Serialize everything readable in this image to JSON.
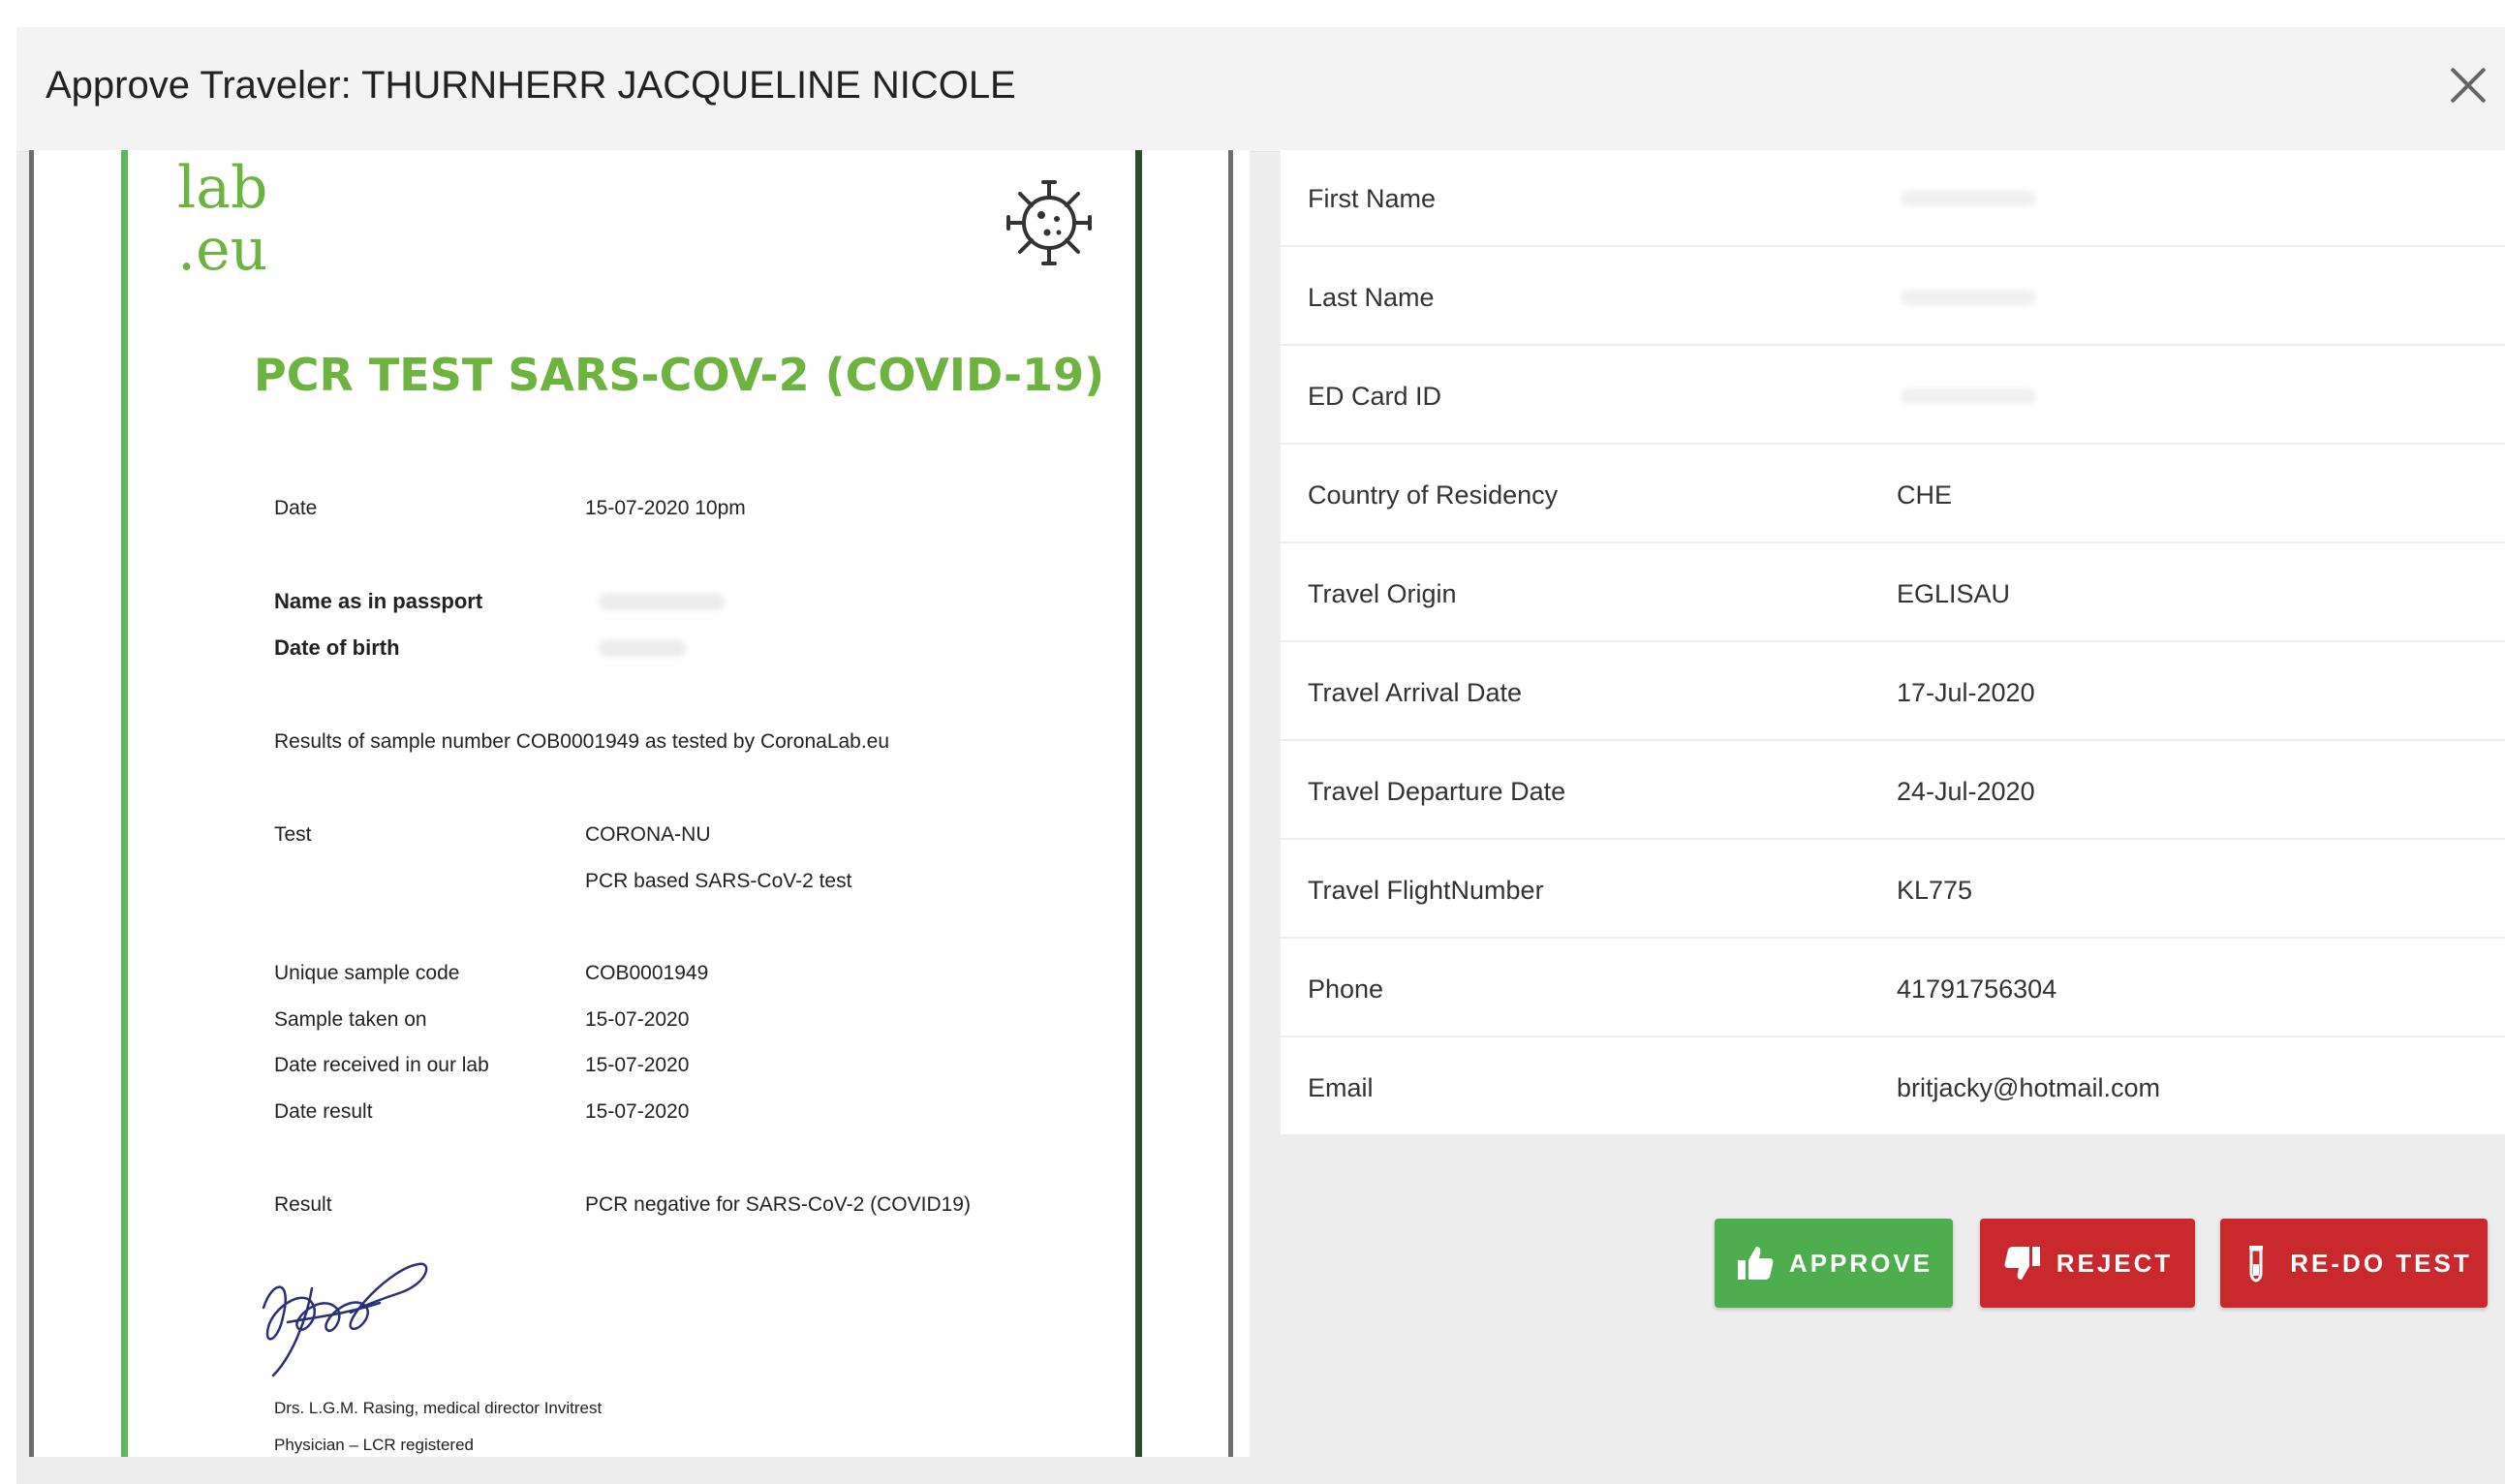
{
  "modal": {
    "title": "Approve Traveler: THURNHERR JACQUELINE NICOLE"
  },
  "document": {
    "logo_line1": "lab",
    "logo_line2": ".eu",
    "heading": "PCR TEST SARS-COV-2 (COVID-19)",
    "date_label": "Date",
    "date_value": "15-07-2020   10pm",
    "name_label": "Name as in passport",
    "dob_label": "Date of birth",
    "results_text": "Results of sample number COB0001949 as tested by CoronaLab.eu",
    "test_label": "Test",
    "test_value1": "CORONA-NU",
    "test_value2": "PCR based SARS-CoV-2 test",
    "sample_code_label": "Unique sample code",
    "sample_code_value": "COB0001949",
    "sample_taken_label": "Sample taken on",
    "sample_taken_value": "15-07-2020",
    "date_received_label": "Date received in our lab",
    "date_received_value": "15-07-2020",
    "date_result_label": "Date result",
    "date_result_value": "15-07-2020",
    "result_label": "Result",
    "result_value": "PCR negative for SARS-CoV-2 (COVID19)",
    "signer_line1": "Drs. L.G.M. Rasing, medical director Invitrest",
    "signer_line2": "Physician – LCR registered"
  },
  "details": [
    {
      "label": "First Name",
      "value": ""
    },
    {
      "label": "Last Name",
      "value": ""
    },
    {
      "label": "ED Card ID",
      "value": ""
    },
    {
      "label": "Country of Residency",
      "value": "CHE"
    },
    {
      "label": "Travel Origin",
      "value": "EGLISAU"
    },
    {
      "label": "Travel Arrival Date",
      "value": "17-Jul-2020"
    },
    {
      "label": "Travel Departure Date",
      "value": "24-Jul-2020"
    },
    {
      "label": "Travel FlightNumber",
      "value": "KL775"
    },
    {
      "label": "Phone",
      "value": "41791756304"
    },
    {
      "label": "Email",
      "value": "britjacky@hotmail.com"
    }
  ],
  "actions": {
    "approve_label": "APPROVE",
    "reject_label": "REJECT",
    "redo_label": "RE-DO TEST",
    "approve_color": "#4cae4c",
    "reject_color": "#c9282d",
    "redo_color": "#c9282d"
  },
  "icons": {
    "close": "close-icon",
    "approve": "thumbs-up-icon",
    "reject": "thumbs-down-icon",
    "redo": "test-tube-icon",
    "virus": "virus-icon"
  }
}
